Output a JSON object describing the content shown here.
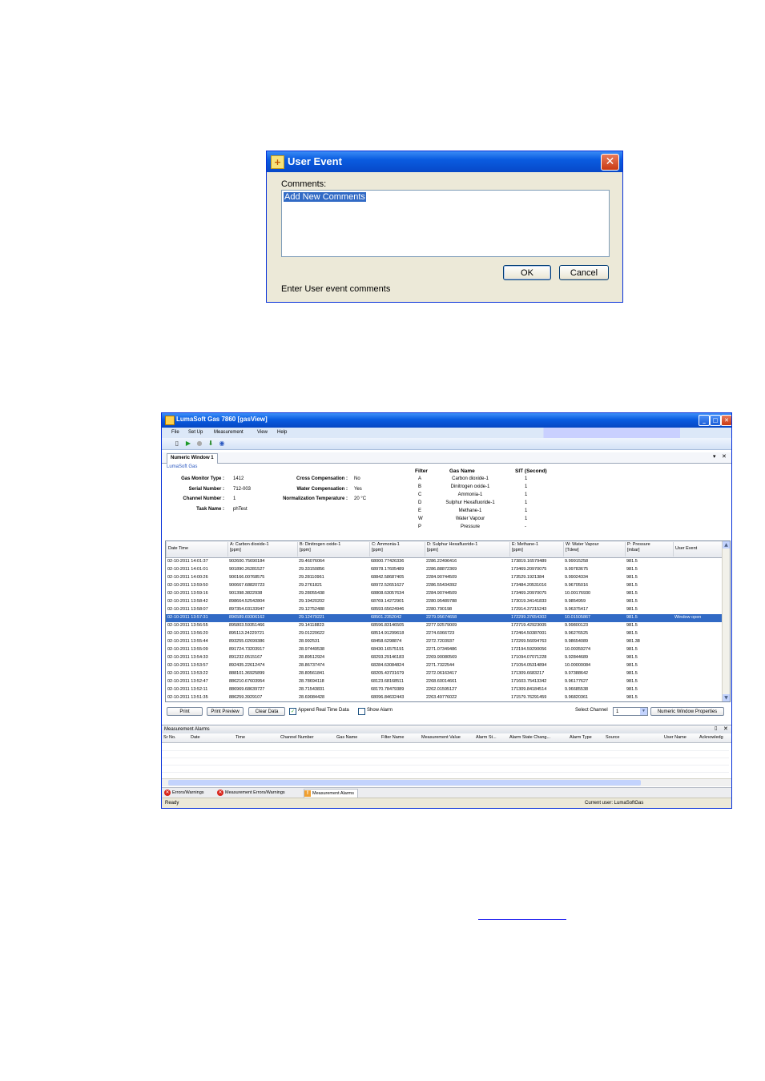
{
  "dialog": {
    "title": "User Event",
    "comments_label": "Comments:",
    "comments_value": "Add New Comments",
    "ok_label": "OK",
    "cancel_label": "Cancel",
    "hint": "Enter User event comments",
    "close_glyph": "✕"
  },
  "app": {
    "title": "LumaSoft Gas 7860 [gasView]",
    "menu": [
      "File",
      "Set Up",
      "Measurement",
      "View",
      "Help"
    ],
    "tab": "Numeric Window 1",
    "brand": "LumaSoft Gas",
    "info_left": [
      {
        "label": "Gas Monitor Type :",
        "value": "1412"
      },
      {
        "label": "Serial Number :",
        "value": "712-003"
      },
      {
        "label": "Channel Number :",
        "value": "1"
      },
      {
        "label": "Task Name :",
        "value": "phTest"
      }
    ],
    "info_mid": [
      {
        "label": "Cross Compensation :",
        "value": "No"
      },
      {
        "label": "Water Compensation :",
        "value": "Yes"
      },
      {
        "label": "Normalization Temperature :",
        "value": "20 °C"
      }
    ],
    "filter_headers": [
      "Filter",
      "Gas Name",
      "SIT (Second)"
    ],
    "filters": [
      {
        "f": "A",
        "gas": "Carbon dioxide-1",
        "sit": "1"
      },
      {
        "f": "B",
        "gas": "Dinitrogen oxide-1",
        "sit": "1"
      },
      {
        "f": "C",
        "gas": "Ammonia-1",
        "sit": "1"
      },
      {
        "f": "D",
        "gas": "Sulphur Hexafluoride-1",
        "sit": "1"
      },
      {
        "f": "E",
        "gas": "Methane-1",
        "sit": "1"
      },
      {
        "f": "W",
        "gas": "Water Vapour",
        "sit": "1"
      },
      {
        "f": "P",
        "gas": "Pressure",
        "sit": "-"
      }
    ],
    "grid_headers": [
      [
        "Date Time",
        ""
      ],
      [
        "A: Carbon dioxide-1",
        "[ppm]"
      ],
      [
        "B: Dinitrogen oxide-1",
        "[ppm]"
      ],
      [
        "C: Ammonia-1",
        "[ppm]"
      ],
      [
        "D: Sulphur Hexafluoride-1",
        "[ppm]"
      ],
      [
        "E: Methane-1",
        "[ppm]"
      ],
      [
        "W: Water Vapour",
        "[Tdew]"
      ],
      [
        "P: Pressure",
        "[mbar]"
      ],
      [
        "User Event",
        ""
      ]
    ],
    "grid_rows": [
      [
        "02-10-2011 14:01:37",
        "902600.75690184",
        "29.46076064",
        "68000.77426336",
        "2286.22496416",
        "173819.16579489",
        "9.99915258",
        "981.5",
        ""
      ],
      [
        "02-10-2011 14:01:01",
        "901890.26281527",
        "29.33150856",
        "68978.17605489",
        "2286.88872369",
        "173469.20970075",
        "9.99783675",
        "981.5",
        ""
      ],
      [
        "02-10-2011 14:00:26",
        "900166.00768575",
        "29.28110961",
        "68842.58687405",
        "2284.90744509",
        "173529.1921384",
        "9.99024334",
        "981.5",
        ""
      ],
      [
        "02-10-2011 13:59:50",
        "900667.68820723",
        "29.2761821",
        "68972.52651627",
        "2286.55434392",
        "173484.20531016",
        "9.96705016",
        "981.5",
        ""
      ],
      [
        "02-10-2011 13:59:16",
        "901398.3822938",
        "29.28055438",
        "68808.63057634",
        "2284.90744509",
        "173469.20970075",
        "10.00176930",
        "981.5",
        ""
      ],
      [
        "02-10-2011 13:58:42",
        "898664.52542804",
        "29.19420202",
        "68769.14272901",
        "2280.95489788",
        "173019.34141833",
        "9.9854959",
        "981.5",
        ""
      ],
      [
        "02-10-2011 13:58:07",
        "897354.03133947",
        "29.12752488",
        "68593.65624946",
        "2280.790198",
        "172914.37215243",
        "9.96375417",
        "981.5",
        ""
      ],
      [
        "02-10-2011 13:57:31",
        "896589.69306162",
        "29.12479221",
        "68501.2352042",
        "2279.95674658",
        "172299.37654302",
        "10.01505867",
        "981.5",
        "Window open"
      ],
      [
        "02-10-2011 13:56:55",
        "895803.59351466",
        "29.14118823",
        "68596.83146505",
        "2277.92579009",
        "172719.42923005",
        "9.99800123",
        "981.5",
        ""
      ],
      [
        "02-10-2011 13:56:20",
        "895113.24229721",
        "29.01220622",
        "68514.91299618",
        "2274.6066723",
        "172464.50387001",
        "9.96276525",
        "981.5",
        ""
      ],
      [
        "02-10-2011 13:55:44",
        "893255.02699386",
        "28.992531",
        "68458.6298874",
        "2272.7203937",
        "172269.56094763",
        "9.98654089",
        "981.38",
        ""
      ],
      [
        "02-10-2011 13:55:09",
        "891724.73203917",
        "28.97449538",
        "68430.16575191",
        "2271.07349486",
        "172194.59290056",
        "10.00359274",
        "981.5",
        ""
      ],
      [
        "02-10-2011 13:54:33",
        "891232.0515167",
        "28.89512924",
        "68293.29146183",
        "2269.90080569",
        "171094.07071228",
        "9.92844689",
        "981.5",
        ""
      ],
      [
        "02-10-2011 13:53:57",
        "892435.22612474",
        "28.86737474",
        "68284.63084824",
        "2271.7322544",
        "171054.05314894",
        "10.00000084",
        "981.5",
        ""
      ],
      [
        "02-10-2011 13:53:22",
        "888101.36925899",
        "28.80561841",
        "68205.43731679",
        "2272.06163417",
        "171309.6683217",
        "9.97388642",
        "981.5",
        ""
      ],
      [
        "02-10-2011 13:52:47",
        "886210.67603954",
        "28.78694118",
        "68123.68168511",
        "2268.60014661",
        "171603.75413342",
        "9.96177627",
        "981.5",
        ""
      ],
      [
        "02-10-2011 13:52:11",
        "886969.68639727",
        "28.71543831",
        "68170.78479389",
        "2262.01595127",
        "171309.84184514",
        "9.96685538",
        "981.5",
        ""
      ],
      [
        "02-10-2011 13:51:35",
        "886259.3929107",
        "28.69084428",
        "68096.84632443",
        "2263.49776022",
        "171579.76291459",
        "9.96820361",
        "981.5",
        ""
      ]
    ],
    "buttons": {
      "print": "Print",
      "preview": "Print Preview",
      "clear": "Clear Data",
      "append": "Append Real Time Data",
      "alarm": "Show Alarm",
      "channel_label": "Select Channel",
      "channel_value": "1",
      "props": "Numeric Window Properties"
    },
    "alarms": {
      "title": "Measurement Alarms",
      "columns": [
        "Sr No.",
        "Date",
        "Time",
        "Channel Number",
        "Gas Name",
        "Filter Name",
        "Measurement Value",
        "Alarm St...",
        "Alarm State Chang...",
        "Alarm Type",
        "Source",
        "User Name",
        "Acknowledg"
      ]
    },
    "bottom_tabs": [
      "Errors/Warnings",
      "Measurement Errors/Warnings",
      "Measurement Alarms"
    ],
    "status_ready": "Ready",
    "status_user": "Current user: LumaSoftGas"
  }
}
